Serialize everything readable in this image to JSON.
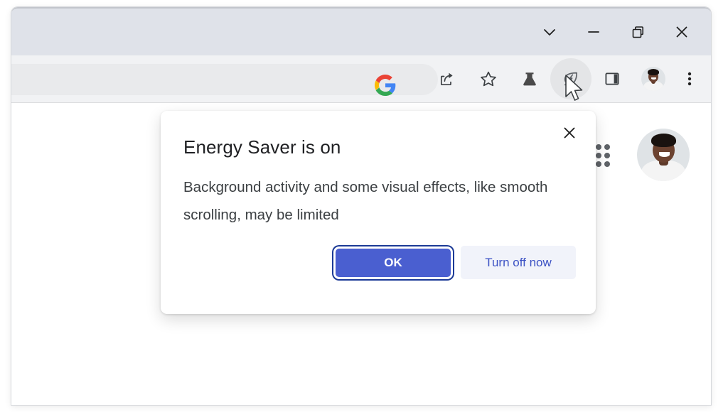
{
  "window": {
    "controls": [
      {
        "name": "tab-search",
        "label": "Search tabs",
        "glyph": "chevron-down-icon"
      },
      {
        "name": "minimize",
        "label": "Minimize",
        "glyph": "minimize-icon"
      },
      {
        "name": "restore",
        "label": "Restore",
        "glyph": "restore-icon"
      },
      {
        "name": "close",
        "label": "Close",
        "glyph": "close-icon"
      }
    ]
  },
  "toolbar": {
    "omnibox_google_icon": "google-g-icon",
    "actions": [
      {
        "name": "share",
        "label": "Share this page",
        "icon": "share-icon"
      },
      {
        "name": "bookmark",
        "label": "Bookmark",
        "icon": "star-icon"
      },
      {
        "name": "chrome-labs",
        "label": "Chrome Labs",
        "icon": "flask-icon"
      },
      {
        "name": "energy-saver",
        "label": "Energy Saver",
        "icon": "leaf-energy-icon"
      },
      {
        "name": "side-panel",
        "label": "Side panel",
        "icon": "side-panel-icon"
      },
      {
        "name": "profile",
        "label": "Profile",
        "icon": "avatar-icon"
      },
      {
        "name": "chrome-menu",
        "label": "Customize and control Google Chrome",
        "icon": "three-dot-menu-icon"
      }
    ]
  },
  "page": {
    "apps_grid_label": "Google apps",
    "account_label": "Google Account"
  },
  "dialog": {
    "title": "Energy Saver is on",
    "body": "Background activity and some visual effects, like smooth scrolling, may be limited",
    "close_label": "Close",
    "primary_button": "OK",
    "secondary_button": "Turn off now"
  },
  "colors": {
    "primary_button_bg": "#4a5fd0",
    "primary_button_focus_ring": "#1c3a96",
    "secondary_button_bg": "#f1f3fa",
    "secondary_button_text": "#3c52c4",
    "title_bar_bg": "#dfe2e9",
    "toolbar_bg": "#f1f2f4",
    "omnibox_bg": "#e9eaec",
    "dialog_bg": "#ffffff",
    "title_text": "#202124",
    "body_text": "#3c4043"
  }
}
